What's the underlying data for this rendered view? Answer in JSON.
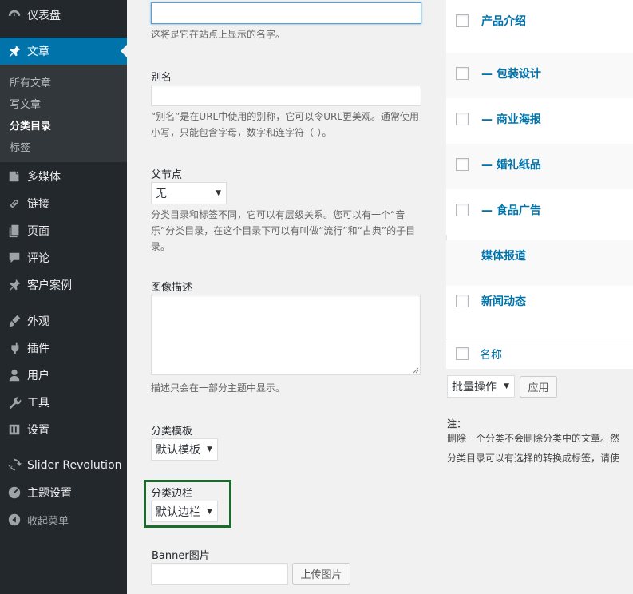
{
  "sidebar": {
    "items": [
      {
        "label": "仪表盘",
        "icon": "dashboard-icon"
      },
      {
        "label": "文章",
        "icon": "pin-icon"
      },
      {
        "label": "多媒体",
        "icon": "media-icon"
      },
      {
        "label": "链接",
        "icon": "link-icon"
      },
      {
        "label": "页面",
        "icon": "page-icon"
      },
      {
        "label": "评论",
        "icon": "comment-icon"
      },
      {
        "label": "客户案例",
        "icon": "pin-icon"
      },
      {
        "label": "外观",
        "icon": "brush-icon"
      },
      {
        "label": "插件",
        "icon": "plugin-icon"
      },
      {
        "label": "用户",
        "icon": "user-icon"
      },
      {
        "label": "工具",
        "icon": "wrench-icon"
      },
      {
        "label": "设置",
        "icon": "settings-icon"
      },
      {
        "label": "Slider Revolution",
        "icon": "refresh-icon"
      },
      {
        "label": "主题设置",
        "icon": "gauge-icon"
      }
    ],
    "submenu": [
      "所有文章",
      "写文章",
      "分类目录",
      "标签"
    ],
    "collapse_label": "收起菜单"
  },
  "form": {
    "name_desc": "这将是它在站点上显示的名字。",
    "slug_label": "别名",
    "slug_desc_1": "“别名”是在URL中使用的别称，它可以令URL更美观。通常使用",
    "slug_desc_2": "小写，只能包含字母，数字和连字符（-）。",
    "parent_label": "父节点",
    "parent_value": "无",
    "parent_desc_1": "分类目录和标签不同，它可以有层级关系。您可以有一个“音",
    "parent_desc_2": "乐”分类目录，在这个目录下可以有叫做“流行”和“古典”的子目",
    "parent_desc_3": "录。",
    "image_label": "图像描述",
    "image_desc": "描述只会在一部分主题中显示。",
    "template_label": "分类模板",
    "template_value": "默认模板",
    "sidebar_label": "分类边栏",
    "sidebar_value": "默认边栏",
    "banner_label": "Banner图片",
    "upload_button": "上传图片"
  },
  "table": {
    "rows": [
      {
        "name": "产品介绍",
        "checkbox": true
      },
      {
        "name": "— 包装设计",
        "checkbox": true
      },
      {
        "name": "— 商业海报",
        "checkbox": true
      },
      {
        "name": "— 婚礼纸品",
        "checkbox": true
      },
      {
        "name": "— 食品广告",
        "checkbox": true
      },
      {
        "name": "媒体报道",
        "checkbox": false
      },
      {
        "name": "新闻动态",
        "checkbox": true
      }
    ],
    "footer_label": "名称",
    "bulk_action": "批量操作",
    "apply_button": "应用"
  },
  "notes": {
    "title": "注：",
    "line1": "删除一个分类不会删除分类中的文章。然",
    "line2": "分类目录可以有选择的转换成标签，请使"
  }
}
